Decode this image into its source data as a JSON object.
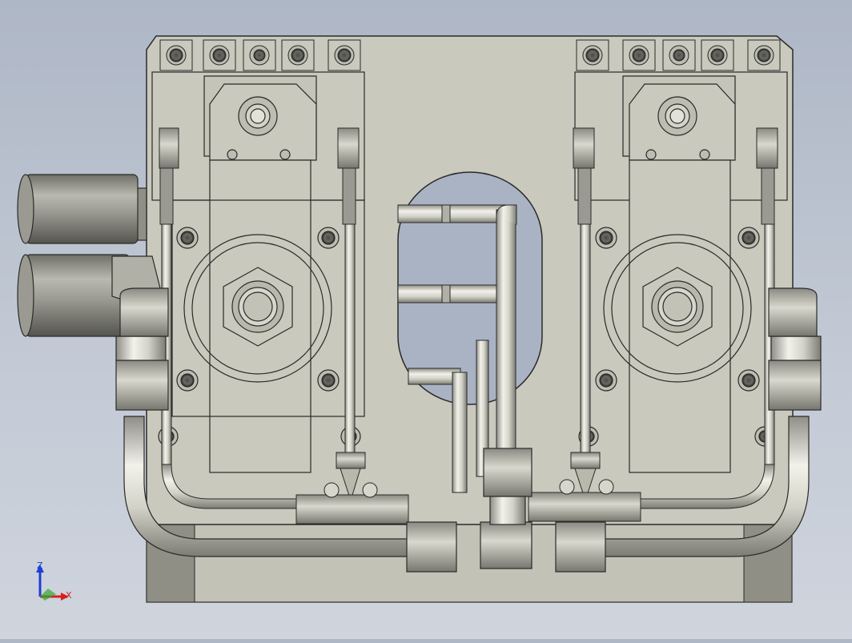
{
  "viewport": {
    "background_top": "#aeb7c6",
    "background_bottom": "#cfd4dd"
  },
  "model": {
    "body_color": "#c9c9bd",
    "edge_color": "#2a2a2a",
    "tube_color": "#d6d6cc",
    "fitting_color": "#b8b8ac",
    "shadow_color": "#8f8f85"
  },
  "triad": {
    "z_label": "Z",
    "x_label": "X",
    "z_color": "#1f3fd6",
    "x_color": "#d62020",
    "y_color": "#2faa2f"
  }
}
